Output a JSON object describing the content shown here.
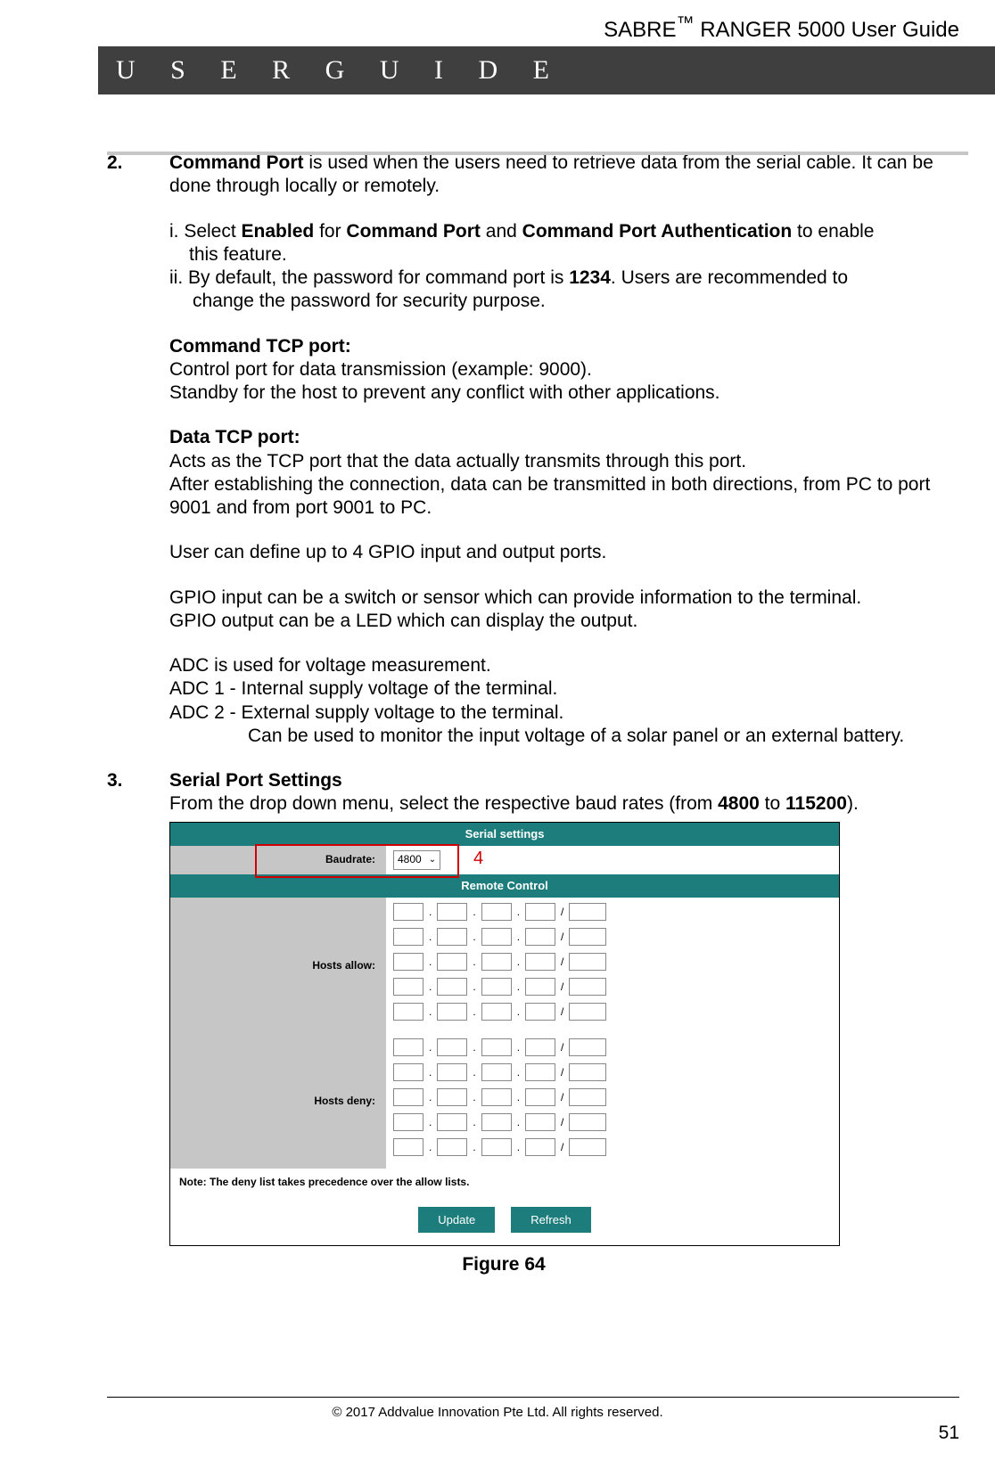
{
  "header": {
    "product": "SABRE",
    "tm": "™",
    "suffix": " RANGER 5000 User Guide",
    "banner": "U S E R   G U I D E"
  },
  "section2": {
    "num": "2.",
    "title": "Command Port",
    "intro_after": " is used when the users need to retrieve data from the serial cable. It can be done through locally or remotely.",
    "step_i_pre": "i. Select ",
    "step_i_b1": "Enabled",
    "step_i_mid1": " for ",
    "step_i_b2": "Command Port",
    "step_i_mid2": " and ",
    "step_i_b3": "Command Port Authentication",
    "step_i_post": " to enable",
    "step_i_line2": "this feature.",
    "step_ii_pre": "ii. By default, the password for command port is ",
    "step_ii_b": "1234",
    "step_ii_post": ". Users are recommended to",
    "step_ii_line2": "change the password for security purpose.",
    "cmd_tcp_head": "Command TCP port:",
    "cmd_tcp_l1": "Control port for data transmission (example: 9000).",
    "cmd_tcp_l2": "Standby for the host to prevent any conflict with other applications.",
    "data_tcp_head": "Data TCP port:",
    "data_tcp_l1": "Acts as the TCP port that the data actually transmits through this port.",
    "data_tcp_l2": "After establishing the connection, data can be transmitted in both directions, from PC to port 9001 and from port 9001 to PC.",
    "gpio_def": "User can define up to 4 GPIO input and output ports.",
    "gpio_in": "GPIO input can be a switch or sensor which can provide information to the terminal.",
    "gpio_out": "GPIO output can be a LED which can display the output.",
    "adc_l1": "ADC is used for voltage measurement.",
    "adc_l2": "ADC 1 - Internal supply voltage of the terminal.",
    "adc_l3": "ADC 2 - External supply voltage to the terminal.",
    "adc_l4": "Can be used to monitor the input voltage of a solar panel or an external battery."
  },
  "section3": {
    "num": "3.",
    "title": "Serial Port Settings",
    "desc_pre": "From the drop down menu, select the respective baud rates (from ",
    "b1": "4800",
    "mid": " to ",
    "b2": "115200",
    "post": ")."
  },
  "figure": {
    "serial_settings": "Serial settings",
    "baudrate_label": "Baudrate:",
    "baudrate_value": "4800",
    "marker": "4",
    "remote_control": "Remote Control",
    "hosts_allow": "Hosts allow:",
    "hosts_deny": "Hosts deny:",
    "note": "Note: The deny list takes precedence over the allow lists.",
    "update": "Update",
    "refresh": "Refresh",
    "caption": "Figure 64"
  },
  "footer": {
    "copy": "© 2017 Addvalue Innovation Pte Ltd. All rights reserved.",
    "page": "51"
  }
}
